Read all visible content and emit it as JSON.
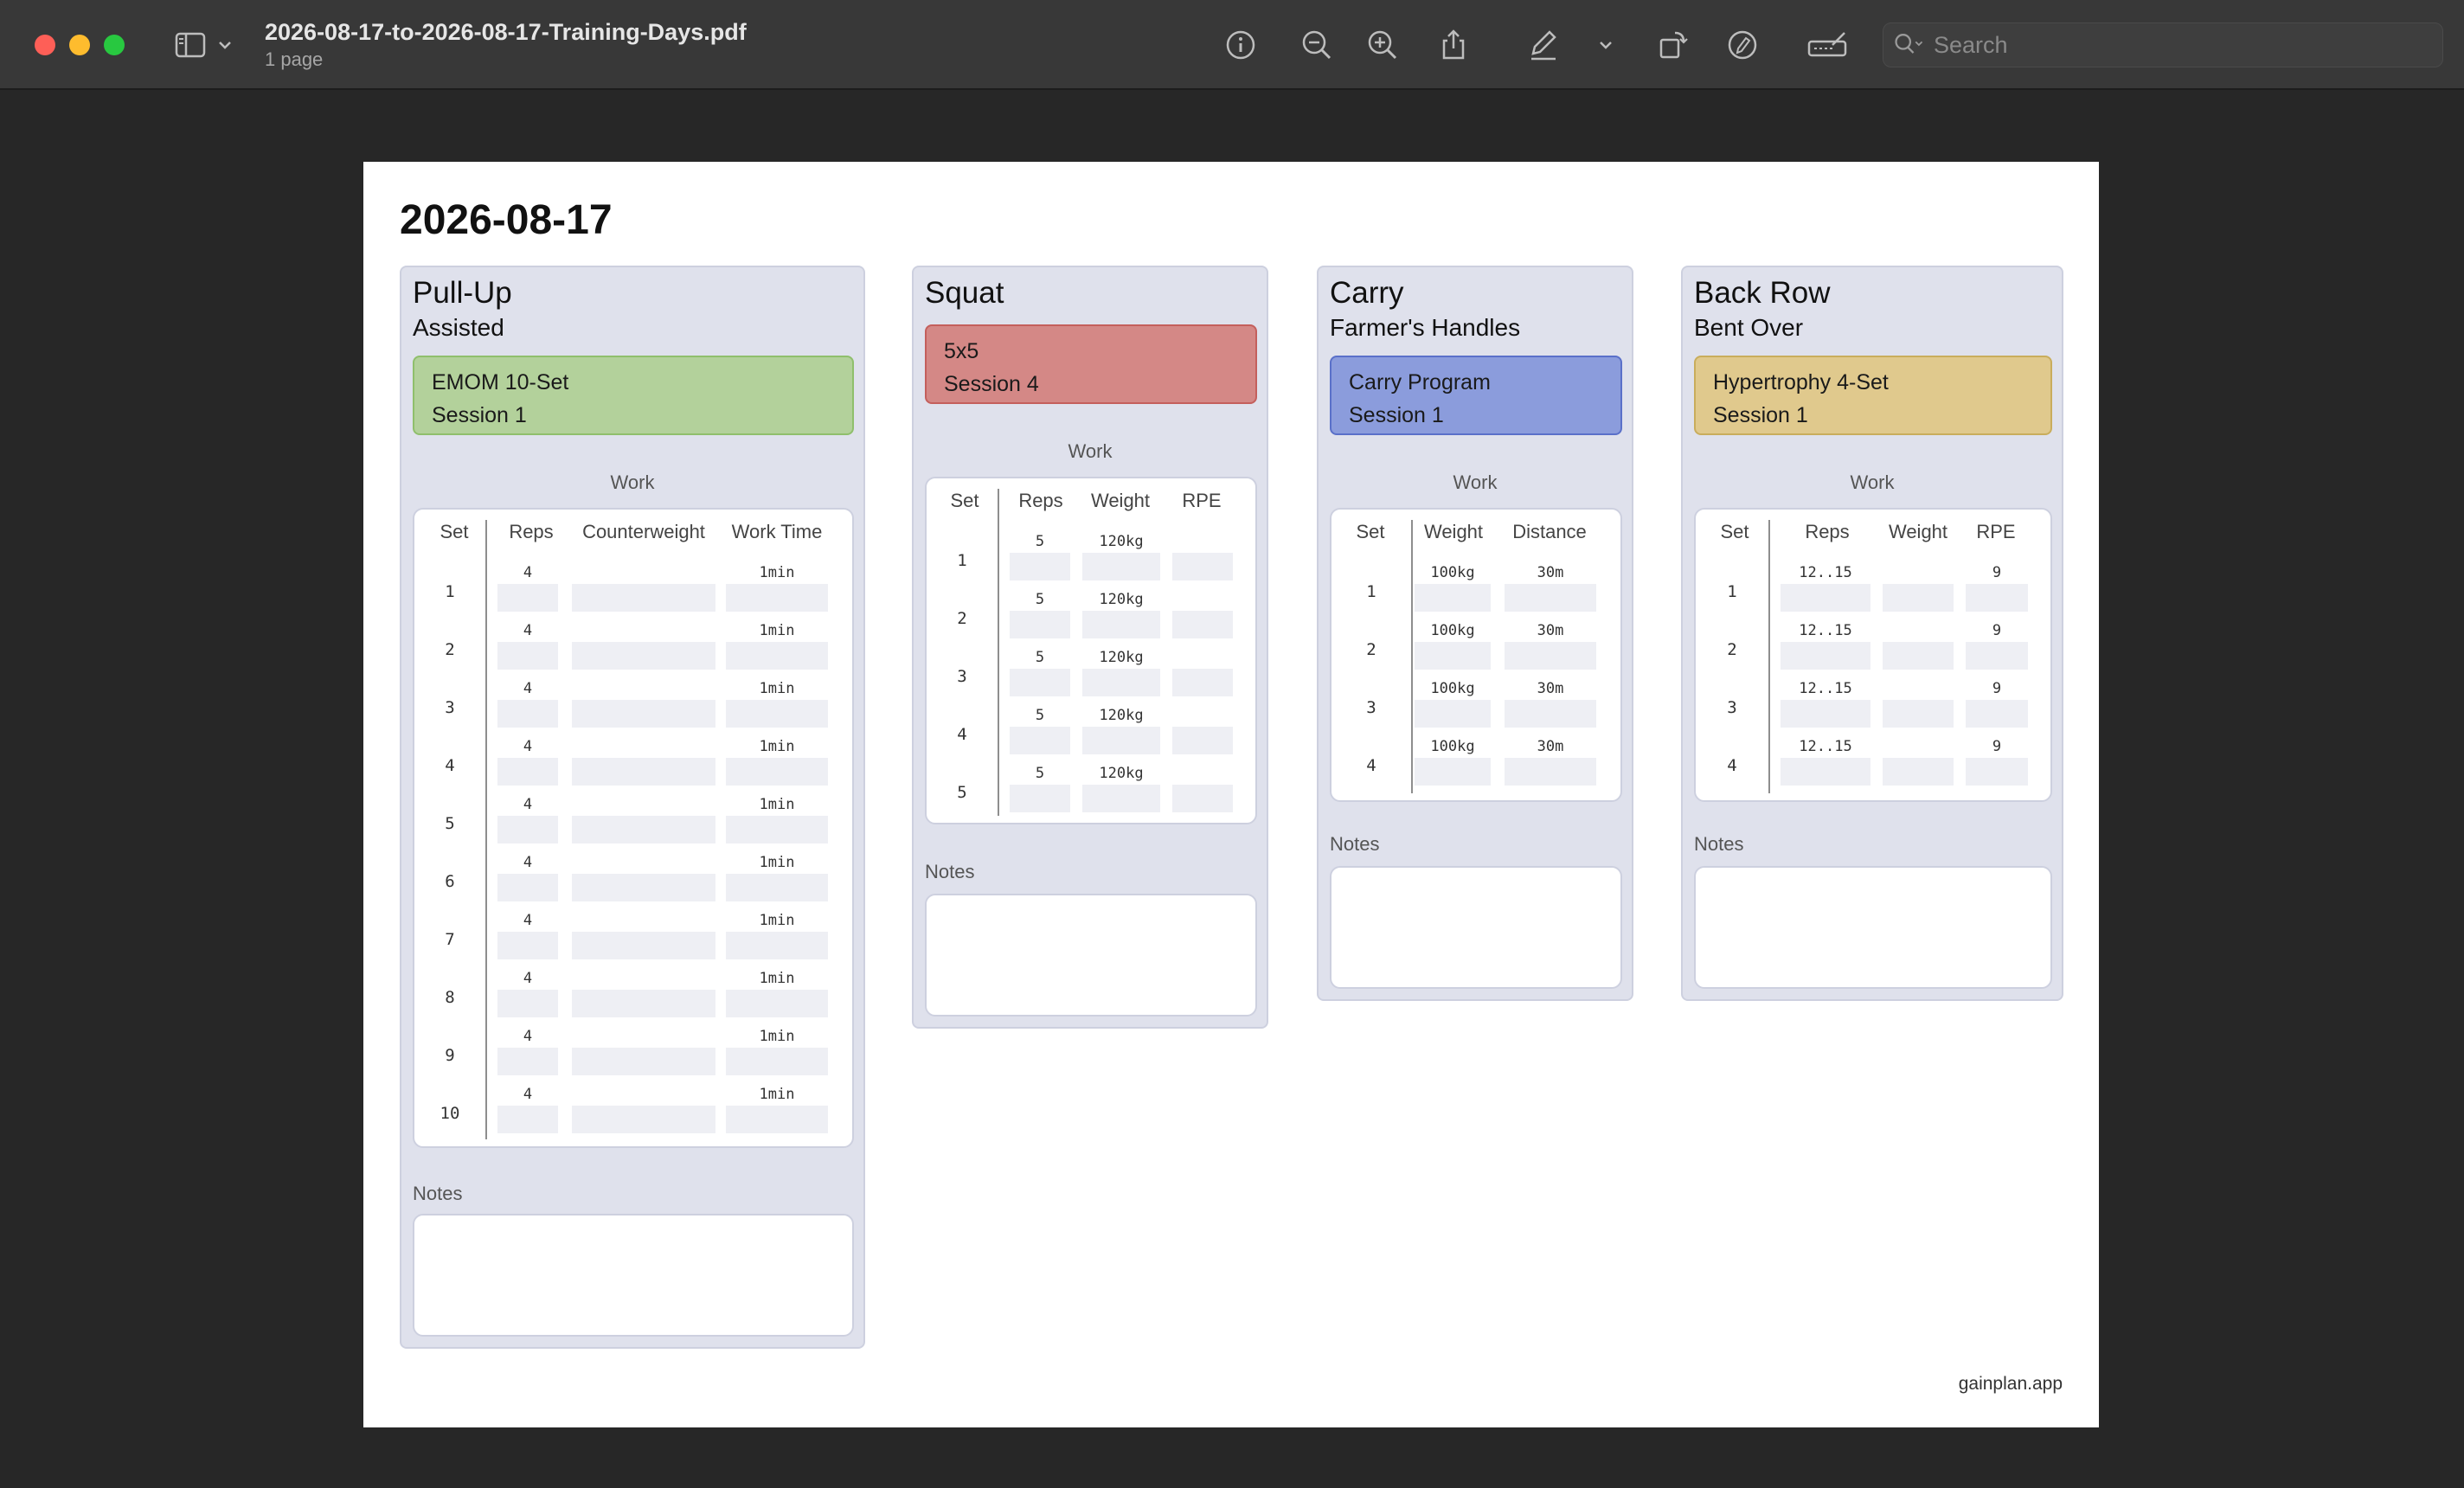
{
  "window": {
    "title": "2026-08-17-to-2026-08-17-Training-Days.pdf",
    "subtitle": "1 page",
    "search_placeholder": "Search"
  },
  "toolbar_icons": [
    "sidebar-icon",
    "chevron-down-icon",
    "info-icon",
    "zoom-out-icon",
    "zoom-in-icon",
    "share-icon",
    "markup-pen-icon",
    "chevron-down-icon",
    "rotate-icon",
    "pen-circle-icon",
    "form-signature-icon",
    "search-icon"
  ],
  "page": {
    "date": "2026-08-17",
    "footer": "gainplan.app",
    "work_label": "Work",
    "notes_label": "Notes"
  },
  "exercises": [
    {
      "name": "Pull-Up",
      "variant": "Assisted",
      "program": "EMOM 10-Set",
      "session": "Session 1",
      "program_color": "#b3d19b",
      "program_border": "#8fbf6c",
      "columns": [
        "Set",
        "Reps",
        "Counterweight",
        "Work Time"
      ],
      "sets": [
        [
          "1",
          "4",
          "",
          "1min"
        ],
        [
          "2",
          "4",
          "",
          "1min"
        ],
        [
          "3",
          "4",
          "",
          "1min"
        ],
        [
          "4",
          "4",
          "",
          "1min"
        ],
        [
          "5",
          "4",
          "",
          "1min"
        ],
        [
          "6",
          "4",
          "",
          "1min"
        ],
        [
          "7",
          "4",
          "",
          "1min"
        ],
        [
          "8",
          "4",
          "",
          "1min"
        ],
        [
          "9",
          "4",
          "",
          "1min"
        ],
        [
          "10",
          "4",
          "",
          "1min"
        ]
      ]
    },
    {
      "name": "Squat",
      "variant": "",
      "program": "5x5",
      "session": "Session 4",
      "program_color": "#d48886",
      "program_border": "#c45f5c",
      "columns": [
        "Set",
        "Reps",
        "Weight",
        "RPE"
      ],
      "sets": [
        [
          "1",
          "5",
          "120kg",
          ""
        ],
        [
          "2",
          "5",
          "120kg",
          ""
        ],
        [
          "3",
          "5",
          "120kg",
          ""
        ],
        [
          "4",
          "5",
          "120kg",
          ""
        ],
        [
          "5",
          "5",
          "120kg",
          ""
        ]
      ]
    },
    {
      "name": "Carry",
      "variant": "Farmer's Handles",
      "program": "Carry Program",
      "session": "Session 1",
      "program_color": "#8b9cdc",
      "program_border": "#5a70c9",
      "columns": [
        "Set",
        "Weight",
        "Distance"
      ],
      "sets": [
        [
          "1",
          "100kg",
          "30m"
        ],
        [
          "2",
          "100kg",
          "30m"
        ],
        [
          "3",
          "100kg",
          "30m"
        ],
        [
          "4",
          "100kg",
          "30m"
        ]
      ]
    },
    {
      "name": "Back Row",
      "variant": "Bent Over",
      "program": "Hypertrophy 4-Set",
      "session": "Session 1",
      "program_color": "#e0c98d",
      "program_border": "#c9ad5c",
      "columns": [
        "Set",
        "Reps",
        "Weight",
        "RPE"
      ],
      "sets": [
        [
          "1",
          "12..15",
          "",
          "9"
        ],
        [
          "2",
          "12..15",
          "",
          "9"
        ],
        [
          "3",
          "12..15",
          "",
          "9"
        ],
        [
          "4",
          "12..15",
          "",
          "9"
        ]
      ]
    }
  ]
}
